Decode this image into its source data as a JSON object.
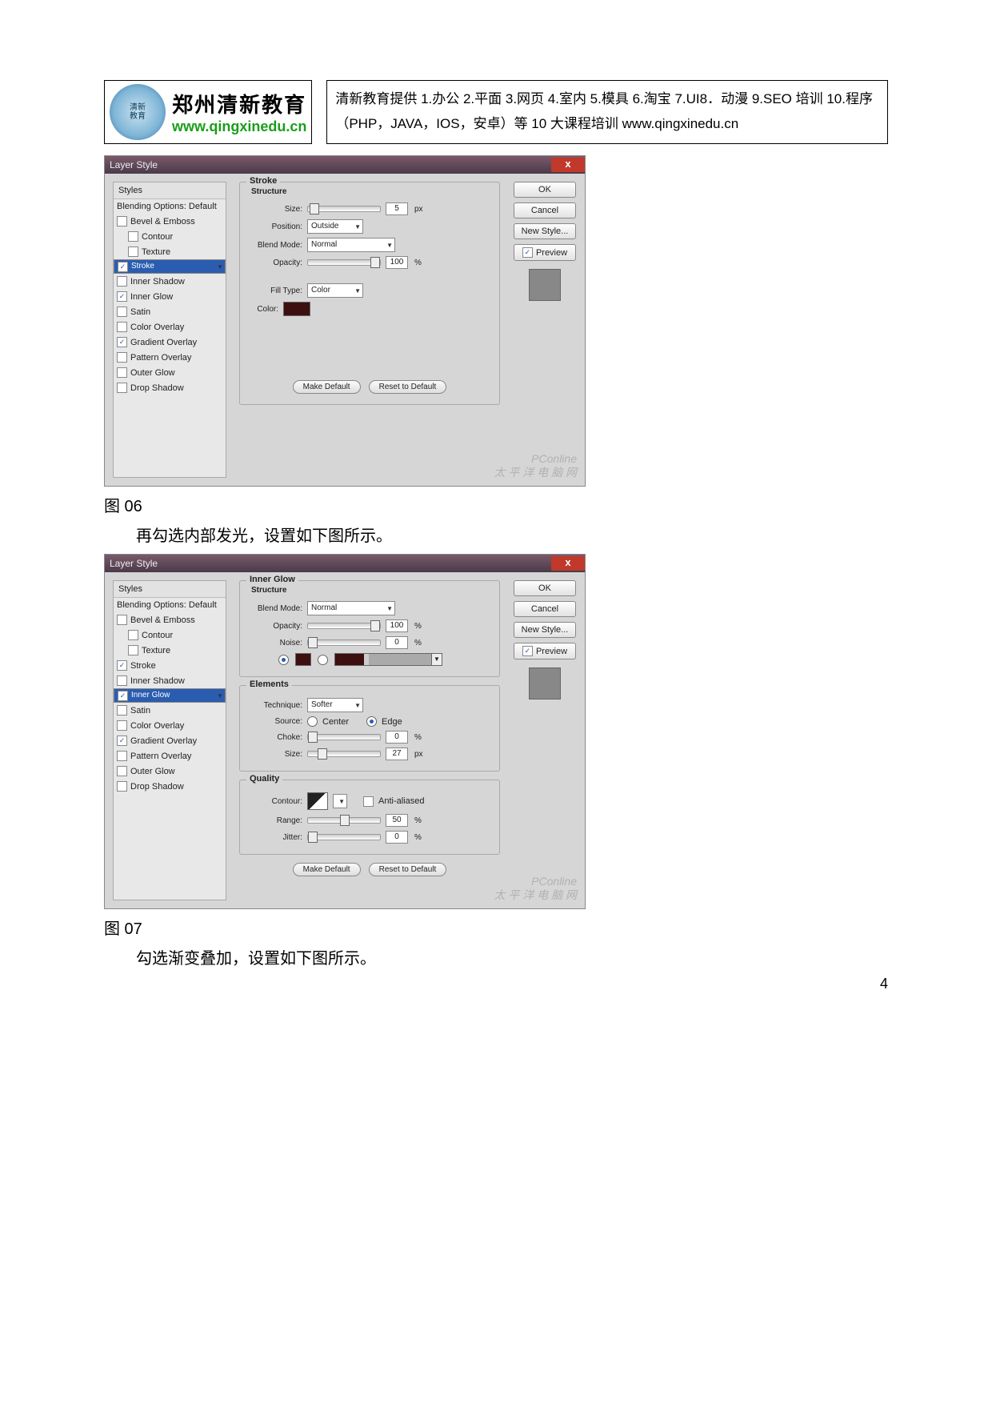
{
  "header": {
    "logo_cn": "郑州清新教育",
    "logo_url": "www.qingxinedu.cn",
    "desc": "清新教育提供 1.办公 2.平面 3.网页 4.室内 5.模具 6.淘宝 7.UI8．动漫 9.SEO 培训 10.程序（PHP，JAVA，IOS，安卓）等 10 大课程培训  www.qingxinedu.cn"
  },
  "captions": {
    "c1": "图 06",
    "t1": "再勾选内部发光，设置如下图所示。",
    "c2": "图 07",
    "t2": "勾选渐变叠加，设置如下图所示。"
  },
  "dlg1": {
    "title": "Layer Style",
    "styles_hdr": "Styles",
    "styles": [
      {
        "label": "Blending Options: Default",
        "ck": null
      },
      {
        "label": "Bevel & Emboss",
        "ck": false
      },
      {
        "label": "Contour",
        "ck": false,
        "sub": true
      },
      {
        "label": "Texture",
        "ck": false,
        "sub": true
      },
      {
        "label": "Stroke",
        "ck": true,
        "sel": true
      },
      {
        "label": "Inner Shadow",
        "ck": false
      },
      {
        "label": "Inner Glow",
        "ck": true
      },
      {
        "label": "Satin",
        "ck": false
      },
      {
        "label": "Color Overlay",
        "ck": false
      },
      {
        "label": "Gradient Overlay",
        "ck": true
      },
      {
        "label": "Pattern Overlay",
        "ck": false
      },
      {
        "label": "Outer Glow",
        "ck": false
      },
      {
        "label": "Drop Shadow",
        "ck": false
      }
    ],
    "panel": "Stroke",
    "sub": "Structure",
    "size_l": "Size:",
    "size_v": "5",
    "size_u": "px",
    "pos_l": "Position:",
    "pos_v": "Outside",
    "bm_l": "Blend Mode:",
    "bm_v": "Normal",
    "op_l": "Opacity:",
    "op_v": "100",
    "op_u": "%",
    "ft_l": "Fill Type:",
    "ft_v": "Color",
    "col_l": "Color:",
    "col_v": "#3d0f0f",
    "mk": "Make Default",
    "rs": "Reset to Default",
    "ok": "OK",
    "cancel": "Cancel",
    "ns": "New Style...",
    "pv": "Preview"
  },
  "dlg2": {
    "title": "Layer Style",
    "styles_hdr": "Styles",
    "styles": [
      {
        "label": "Blending Options: Default",
        "ck": null
      },
      {
        "label": "Bevel & Emboss",
        "ck": false
      },
      {
        "label": "Contour",
        "ck": false,
        "sub": true
      },
      {
        "label": "Texture",
        "ck": false,
        "sub": true
      },
      {
        "label": "Stroke",
        "ck": true
      },
      {
        "label": "Inner Shadow",
        "ck": false
      },
      {
        "label": "Inner Glow",
        "ck": true,
        "sel": true
      },
      {
        "label": "Satin",
        "ck": false
      },
      {
        "label": "Color Overlay",
        "ck": false
      },
      {
        "label": "Gradient Overlay",
        "ck": true
      },
      {
        "label": "Pattern Overlay",
        "ck": false
      },
      {
        "label": "Outer Glow",
        "ck": false
      },
      {
        "label": "Drop Shadow",
        "ck": false
      }
    ],
    "panel": "Inner Glow",
    "sub": "Structure",
    "bm_l": "Blend Mode:",
    "bm_v": "Normal",
    "op_l": "Opacity:",
    "op_v": "100",
    "op_u": "%",
    "nz_l": "Noise:",
    "nz_v": "0",
    "nz_u": "%",
    "elements": "Elements",
    "tq_l": "Technique:",
    "tq_v": "Softer",
    "src_l": "Source:",
    "src_c": "Center",
    "src_e": "Edge",
    "ch_l": "Choke:",
    "ch_v": "0",
    "ch_u": "%",
    "sz_l": "Size:",
    "sz_v": "27",
    "sz_u": "px",
    "quality": "Quality",
    "ct_l": "Contour:",
    "aa": "Anti-aliased",
    "rg_l": "Range:",
    "rg_v": "50",
    "rg_u": "%",
    "jt_l": "Jitter:",
    "jt_v": "0",
    "jt_u": "%",
    "mk": "Make Default",
    "rs": "Reset to Default",
    "ok": "OK",
    "cancel": "Cancel",
    "ns": "New Style...",
    "pv": "Preview"
  },
  "wm1": "PConline",
  "wm2": "太 平 洋 电 脑 网",
  "pagenum": "4"
}
